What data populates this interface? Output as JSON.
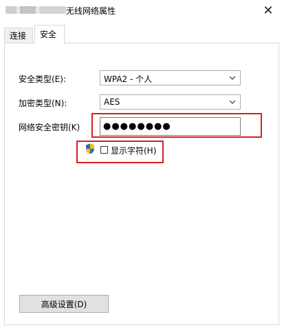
{
  "window": {
    "title": "无线网络属性",
    "close_symbol": "✕"
  },
  "tabs": [
    {
      "label": "连接",
      "active": false
    },
    {
      "label": "安全",
      "active": true
    }
  ],
  "security": {
    "security_type_label": "安全类型(E):",
    "security_type_value": "WPA2 - 个人",
    "encryption_type_label": "加密类型(N):",
    "encryption_type_value": "AES",
    "key_label": "网络安全密钥(K)",
    "key_value_masked": "●●●●●●●●",
    "show_chars_label": "显示字符(H)",
    "show_chars_checked": false
  },
  "buttons": {
    "advanced_label": "高级设置(D)"
  },
  "icons": {
    "shield": "uac-shield-icon",
    "dropdown": "chevron-down-icon",
    "close": "close-icon"
  },
  "colors": {
    "highlight_box": "#d32020",
    "shield_blue": "#2b6cc4",
    "shield_yellow": "#f2c200"
  }
}
